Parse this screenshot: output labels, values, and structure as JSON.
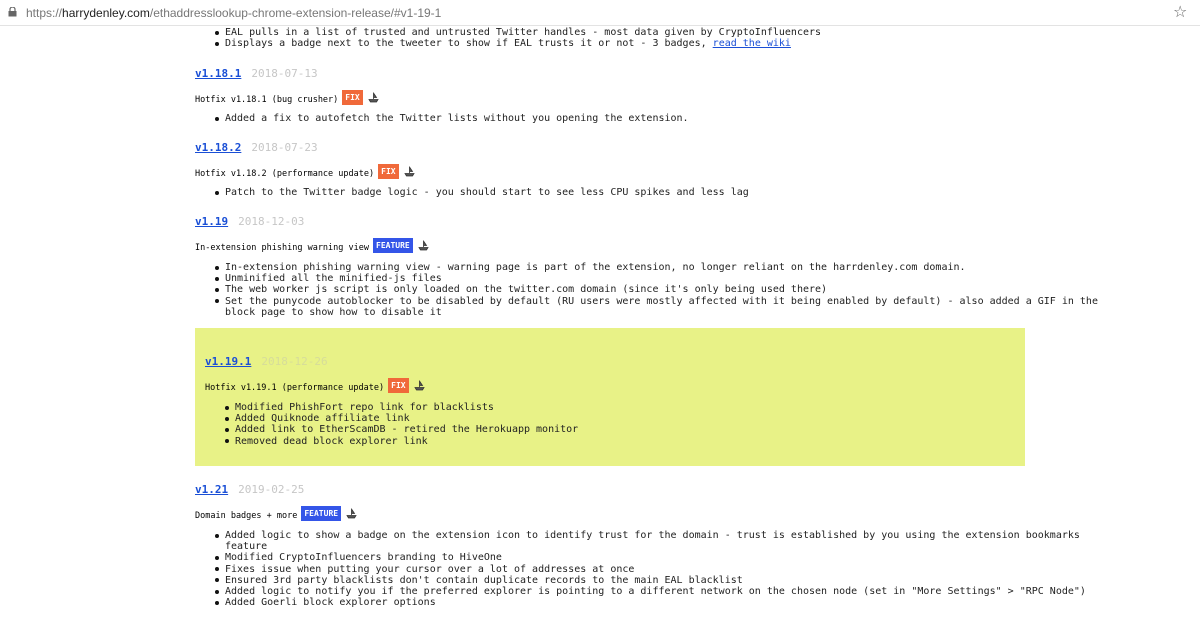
{
  "browser": {
    "url_prefix": "https://",
    "url_domain": "harrydenley.com",
    "url_path": "/ethaddresslookup-chrome-extension-release/#v1-19-1",
    "star_icon": "star-icon",
    "lock_icon": "lock-icon"
  },
  "top_bullets": [
    "EAL pulls in a list of trusted and untrusted Twitter handles - most data given by CryptoInfluencers",
    "Displays a badge next to the tweeter to show if EAL trusts it or not - 3 badges, "
  ],
  "wiki_link": "read the wiki",
  "releases": [
    {
      "version": "v1.18.1",
      "date": "2018-07-13",
      "title": "Hotfix v1.18.1 (bug crusher)",
      "badge": "FIX",
      "bullets": [
        "Added a fix to autofetch the Twitter lists without you opening the extension."
      ]
    },
    {
      "version": "v1.18.2",
      "date": "2018-07-23",
      "title": "Hotfix v1.18.2 (performance update)",
      "badge": "FIX",
      "bullets": [
        "Patch to the Twitter badge logic - you should start to see less CPU spikes and less lag"
      ]
    },
    {
      "version": "v1.19",
      "date": "2018-12-03",
      "title": "In-extension phishing warning view",
      "badge": "FEATURE",
      "bullets": [
        "In-extension phishing warning view - warning page is part of the extension, no longer reliant on the harrdenley.com domain.",
        "Unminified all the minified-js files",
        "The web worker js script is only loaded on the twitter.com domain (since it's only being used there)",
        "Set the punycode autoblocker to be disabled by default (RU users were mostly affected with it being enabled by default) - also added a GIF in the",
        "block page to show how to disable it"
      ]
    },
    {
      "version": "v1.19.1",
      "date": "2018-12-26",
      "title": "Hotfix v1.19.1 (performance update)",
      "badge": "FIX",
      "bullets": [
        "Modified PhishFort repo link for blacklists",
        "Added Quiknode affiliate link",
        "Added link to EtherScamDB - retired the Herokuapp monitor",
        "Removed dead block explorer link"
      ]
    },
    {
      "version": "v1.21",
      "date": "2019-02-25",
      "title": "Domain badges + more",
      "badge": "FEATURE",
      "bullets": [
        "Added logic to show a badge on the extension icon to identify trust for the domain - trust is established by you using the extension bookmarks",
        "feature",
        "Modified CryptoInfluencers branding to HiveOne",
        "Fixes issue when putting your cursor over a lot of addresses at once",
        "Ensured 3rd party blacklists don't contain duplicate records to the main EAL blacklist",
        "Added logic to notify you if the preferred explorer is pointing to a different network on the chosen node (set in \"More Settings\" > \"RPC Node\")",
        "Added Goerli block explorer options"
      ]
    }
  ],
  "colors": {
    "link": "#1a4fd6",
    "fix_badge": "#f0693a",
    "feature_badge": "#3455e8",
    "highlight": "#e8f287"
  }
}
